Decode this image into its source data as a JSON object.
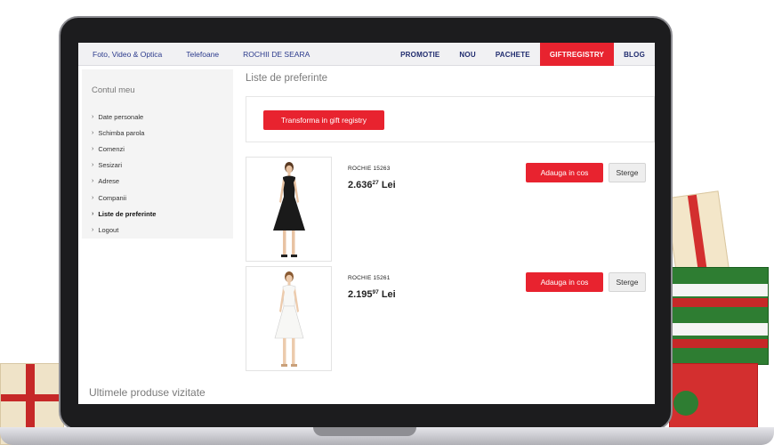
{
  "nav": {
    "left": [
      "Foto, Video & Optica",
      "Telefoane",
      "ROCHII DE SEARA"
    ],
    "right": [
      {
        "label": "PROMOTIE",
        "active": false
      },
      {
        "label": "NOU",
        "active": false
      },
      {
        "label": "PACHETE",
        "active": false
      },
      {
        "label": "GIFTREGISTRY",
        "active": true
      },
      {
        "label": "BLOG",
        "active": false
      }
    ]
  },
  "sidebar": {
    "title": "Contul meu",
    "items": [
      {
        "label": "Date personale",
        "active": false
      },
      {
        "label": "Schimba parola",
        "active": false
      },
      {
        "label": "Comenzi",
        "active": false
      },
      {
        "label": "Sesizari",
        "active": false
      },
      {
        "label": "Adrese",
        "active": false
      },
      {
        "label": "Companii",
        "active": false
      },
      {
        "label": "Liste de preferinte",
        "active": true
      },
      {
        "label": "Logout",
        "active": false
      }
    ]
  },
  "main": {
    "title": "Liste de preferinte",
    "registry_button": "Transforma in gift registry",
    "products": [
      {
        "name": "ROCHIE 15263",
        "price_int": "2.636",
        "price_dec": "27",
        "currency": "Lei",
        "dress_color": "#1a1a1a",
        "cart_label": "Adauga in cos",
        "delete_label": "Sterge"
      },
      {
        "name": "ROCHIE 15261",
        "price_int": "2.195",
        "price_dec": "97",
        "currency": "Lei",
        "dress_color": "#f7f7f5",
        "cart_label": "Adauga in cos",
        "delete_label": "Sterge"
      }
    ],
    "recent_title": "Ultimele produse vizitate"
  },
  "colors": {
    "accent": "#e8232f",
    "nav_text": "#1f2b6e"
  }
}
